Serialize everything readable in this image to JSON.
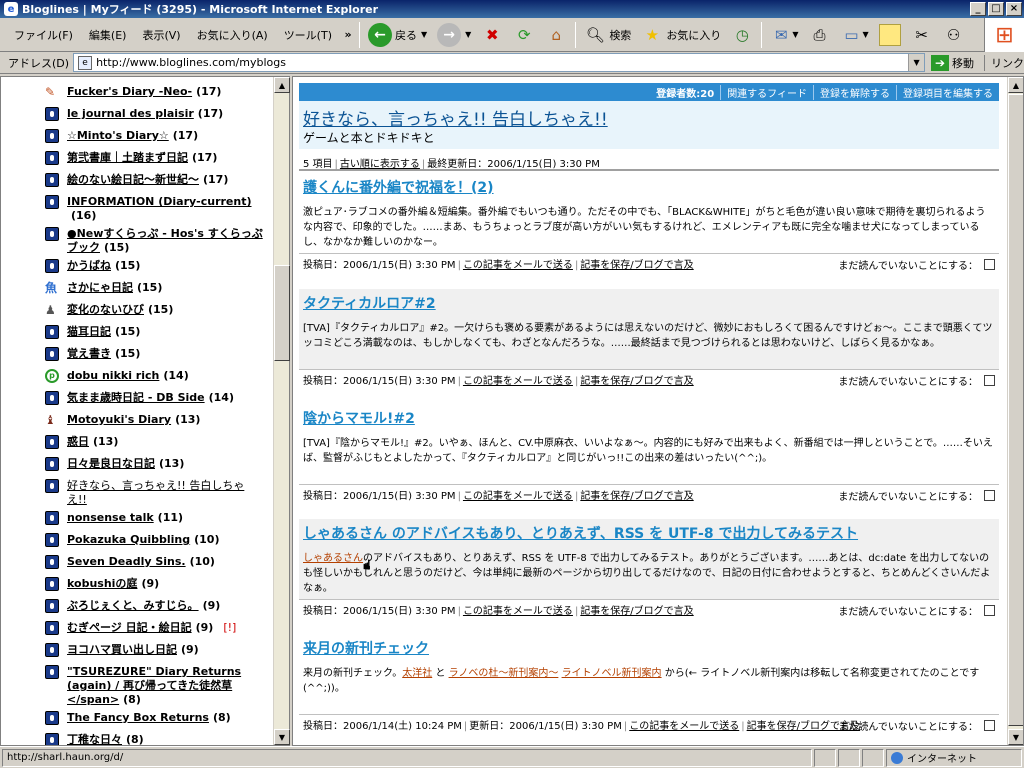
{
  "window": {
    "title": "Bloglines | Myフィード (3295) - Microsoft Internet Explorer"
  },
  "menu": [
    "ファイル(F)",
    "編集(E)",
    "表示(V)",
    "お気に入り(A)",
    "ツール(T)"
  ],
  "toolbar": {
    "back": "戻る",
    "search": "検索",
    "favorites": "お気に入り"
  },
  "address": {
    "label": "アドレス(D)",
    "url": "http://www.bloglines.com/myblogs",
    "go": "移動",
    "links": "リンク"
  },
  "sidebar": {
    "items": [
      {
        "title": "Fucker's Diary -Neo-",
        "count": "(17)",
        "icon": "pen"
      },
      {
        "title": "le journal des plaisir",
        "count": "(17)",
        "icon": "dk"
      },
      {
        "title": "☆Minto's Diary☆",
        "count": "(17)",
        "icon": "dk"
      },
      {
        "title": "第弐書庫｜土踏まず日記",
        "count": "(17)",
        "icon": "dk"
      },
      {
        "title": "絵のない絵日記〜新世紀〜",
        "count": "(17)",
        "icon": "dk"
      },
      {
        "title": "INFORMATION (Diary-current)",
        "count": "(16)",
        "icon": "dk"
      },
      {
        "title": "●Newすくらっぷ - Hos's すくらっぷブック",
        "count": "(15)",
        "icon": "dk"
      },
      {
        "title": "かうばね",
        "count": "(15)",
        "icon": "dk"
      },
      {
        "title": "さかにゃ日記",
        "count": "(15)",
        "icon": "fish"
      },
      {
        "title": "変化のないひび",
        "count": "(15)",
        "icon": "pawn"
      },
      {
        "title": "猫耳日記",
        "count": "(15)",
        "icon": "dk"
      },
      {
        "title": "覚え書き",
        "count": "(15)",
        "icon": "dk"
      },
      {
        "title": "dobu nikki rich",
        "count": "(14)",
        "icon": "green"
      },
      {
        "title": "気まま歳時日記 - DB Side",
        "count": "(14)",
        "icon": "dk"
      },
      {
        "title": "Motoyuki's Diary",
        "count": "(13)",
        "icon": "fig"
      },
      {
        "title": "惑日",
        "count": "(13)",
        "icon": "dk"
      },
      {
        "title": "日々是良日な日記",
        "count": "(13)",
        "icon": "dk"
      },
      {
        "title": "好きなら、言っちゃえ!! 告白しちゃえ!!",
        "count": "",
        "icon": "dk",
        "read": true
      },
      {
        "title": "nonsense talk",
        "count": "(11)",
        "icon": "dk"
      },
      {
        "title": "Pokazuka Quibbling",
        "count": "(10)",
        "icon": "dk"
      },
      {
        "title": "Seven Deadly Sins.",
        "count": "(10)",
        "icon": "dk"
      },
      {
        "title": "kobushiの庭",
        "count": "(9)",
        "icon": "dk"
      },
      {
        "title": "ぶろじぇくと、みすじら。",
        "count": "(9)",
        "icon": "dk"
      },
      {
        "title": "むぎページ 日記・絵日記",
        "count": "(9)",
        "icon": "dk",
        "flag": "[!]"
      },
      {
        "title": "ヨコハマ買い出し日記",
        "count": "(9)",
        "icon": "dk"
      },
      {
        "title": "\"TSUREZURE\" Diary Returns (again) / 再び帰ってきた徒然草</span>",
        "count": "(8)",
        "icon": "dk"
      },
      {
        "title": "The Fancy Box Returns",
        "count": "(8)",
        "icon": "dk"
      },
      {
        "title": "丁稚な日々",
        "count": "(8)",
        "icon": "dk"
      }
    ]
  },
  "feed": {
    "subscribers": "登録者数:20",
    "actions": [
      "関連するフィード",
      "登録を解除する",
      "登録項目を編集する"
    ],
    "title": "好きなら、言っちゃえ!! 告白しちゃえ!!",
    "description": "ゲームと本とドキドキと",
    "meta": {
      "items": "5 項目",
      "older": "古い順に表示する",
      "updated": "最終更新日：2006/1/15(日) 3:30 PM"
    }
  },
  "posts": [
    {
      "title": "護くんに番外編で祝福を！(2)",
      "body": "激ピュア･ラブコメの番外編＆短編集。番外編でもいつも通り。ただその中でも、「BLACK&WHITE」がちと毛色が違い良い意味で期待を裏切られるような内容で、印象的でした。……まあ、もうちょっとラブ度が高い方がいい気もするけれど、エメレンティアも既に完全な噛ませ犬になってしまっているし、なかなか難しいのかなー。",
      "posted": "投稿日：2006/1/15(日) 3:30 PM",
      "mail": "この記事をメールで送る",
      "save": "記事を保存/ブログで言及",
      "unread": "まだ読んでいないことにする："
    },
    {
      "title": "タクティカルロア#2",
      "body": "[TVA]『タクティカルロア』#2。一欠けらも褒める要素があるようには思えないのだけど、微妙におもしろくて困るんですけどぉ〜。ここまで頭悪くてツッコミどころ満載なのは、もしかしなくても、わざとなんだろうな。……最終話まで見つづけられるとは思わないけど、しばらく見るかなぁ。",
      "posted": "投稿日：2006/1/15(日) 3:30 PM",
      "mail": "この記事をメールで送る",
      "save": "記事を保存/ブログで言及",
      "unread": "まだ読んでいないことにする："
    },
    {
      "title": "陰からマモル!#2",
      "body": "[TVA]『陰からマモル!』#2。いやぁ、ほんと、CV.中原麻衣、いいよなぁ〜。内容的にも好みで出来もよく、新番組では一押しということで。……そいえば、監督がふじもとよしたかって、『タクティカルロア』と同じがいっ!!この出来の差はいったい(^^;)。",
      "posted": "投稿日：2006/1/15(日) 3:30 PM",
      "mail": "この記事をメールで送る",
      "save": "記事を保存/ブログで言及",
      "unread": "まだ読んでいないことにする："
    },
    {
      "title": "しゃあるさん のアドバイスもあり、とりあえず、RSS を UTF-8 で出力してみるテスト",
      "body_link": "しゃあるさん",
      "body_rest": "のアドバイスもあり、とりあえず、RSS を UTF-8 で出力してみるテスト。ありがとうございます。……あとは、dc:date を出力してないのも怪しいかもしれんと思うのだけど、今は単純に最新のページから切り出してるだけなので、日記の日付に合わせようとすると、ちとめんどくさいんだよなぁ。",
      "posted": "投稿日：2006/1/15(日) 3:30 PM",
      "mail": "この記事をメールで送る",
      "save": "記事を保存/ブログで言及",
      "unread": "まだ読んでいないことにする："
    },
    {
      "title": "来月の新刊チェック",
      "body_pre": "来月の新刊チェック。",
      "link1": "太洋社",
      "and1": " と ",
      "link2": "ラノベの杜〜新刊案内〜",
      "sp": " ",
      "link3": "ライトノベル新刊案内",
      "body_post": " から(← ライトノベル新刊案内は移転して名称変更されてたのことです(^^;))。",
      "posted": "投稿日：2006/1/14(土) 10:24 PM",
      "updated": "更新日：2006/1/15(日) 3:30 PM",
      "mail": "この記事をメールで送る",
      "save": "記事を保存/ブログで言及",
      "unread": "まだ読んでいないことにする："
    }
  ],
  "status": {
    "url": "http://sharl.haun.org/d/",
    "zone": "インターネット"
  }
}
